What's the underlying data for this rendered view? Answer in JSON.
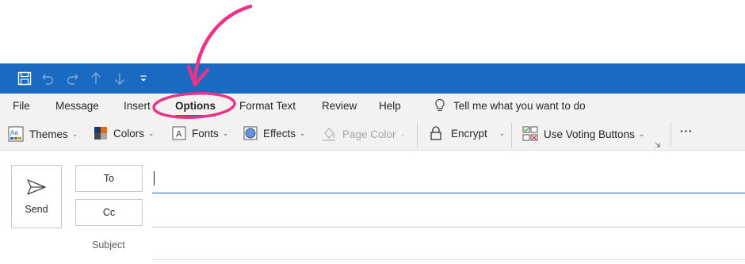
{
  "colors": {
    "accent": "#1b6ac2",
    "annotation": "#e8358a",
    "ribbon_bg": "#f3f2f1"
  },
  "quick_access": {
    "icons": [
      "save-icon",
      "undo-icon",
      "redo-icon",
      "up-arrow-icon",
      "down-arrow-icon",
      "customize-qat-icon"
    ]
  },
  "tabs": {
    "file": "File",
    "message": "Message",
    "insert": "Insert",
    "options": "Options",
    "format_text": "Format Text",
    "review": "Review",
    "help": "Help",
    "active": "Options"
  },
  "tell_me": {
    "label": "Tell me what you want to do",
    "icon": "lightbulb-icon"
  },
  "ribbon": {
    "themes": "Themes",
    "colors": "Colors",
    "fonts": "Fonts",
    "effects": "Effects",
    "page_color": "Page Color",
    "encrypt": "Encrypt",
    "voting": "Use Voting Buttons",
    "more": "···",
    "caret": "⌄"
  },
  "compose": {
    "send": "Send",
    "to": "To",
    "cc": "Cc",
    "subject": "Subject"
  }
}
